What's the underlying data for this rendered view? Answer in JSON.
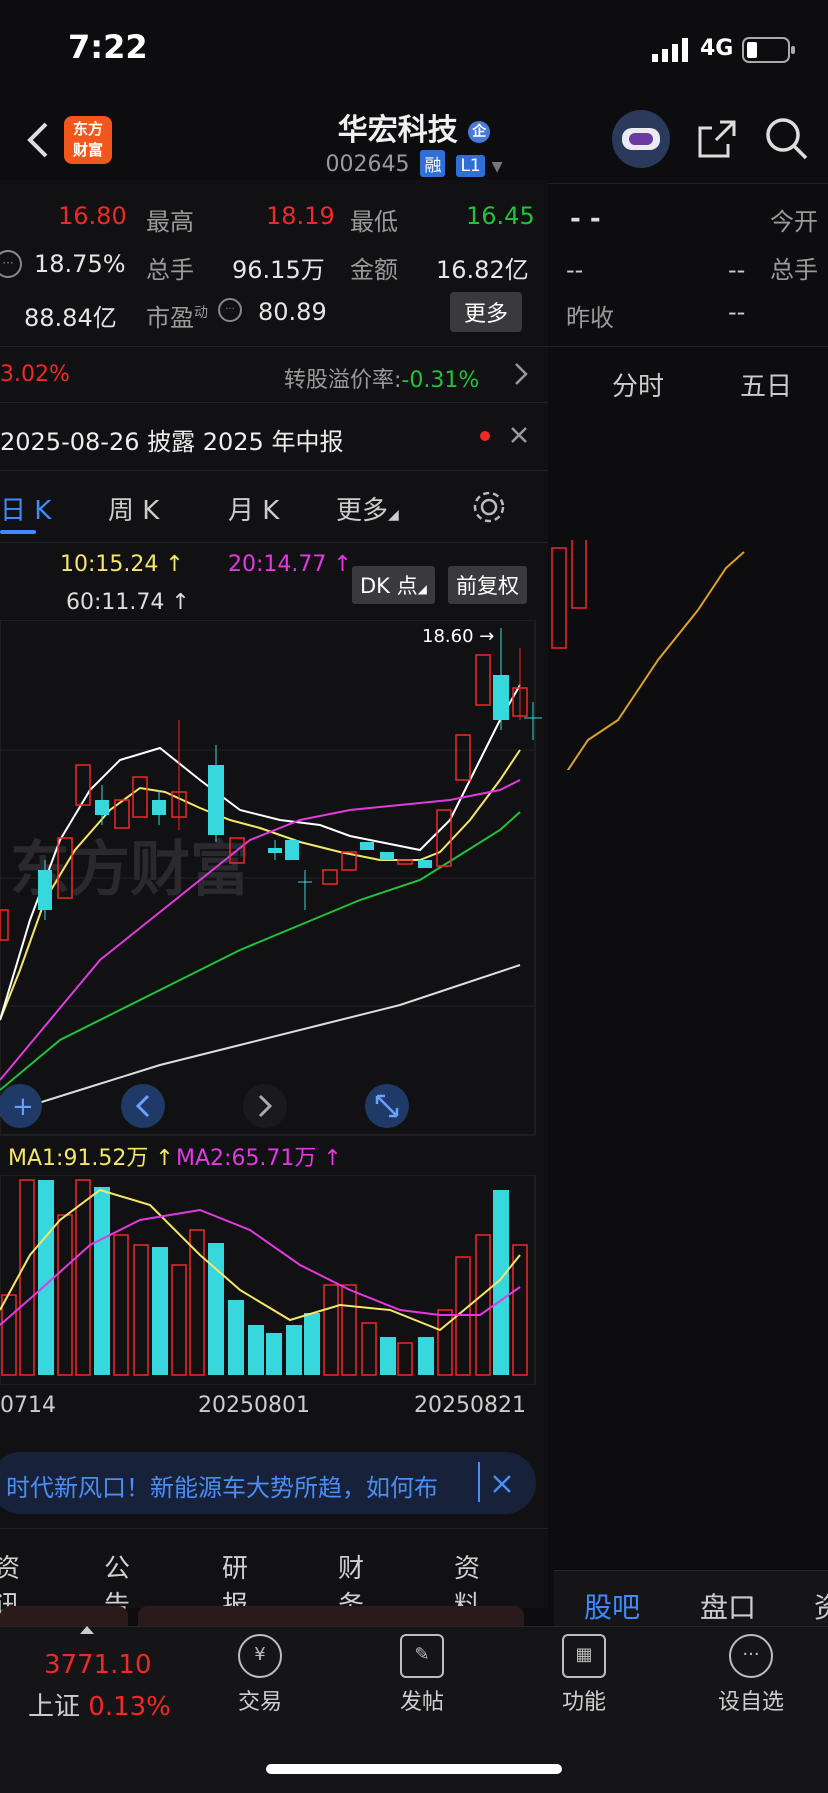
{
  "status": {
    "time": "7:22",
    "network": "4G"
  },
  "header": {
    "logo_text_1": "东方",
    "logo_text_2": "财富",
    "title": "华宏科技",
    "badge": "企",
    "code": "002645",
    "tag1": "融",
    "tag2": "L1"
  },
  "quote": {
    "row1": {
      "v0": "16.80",
      "l1": "最高",
      "v1": "18.19",
      "l2": "最低",
      "v2": "16.45"
    },
    "row2": {
      "v0": "18.75%",
      "l1": "总手",
      "v1": "96.15万",
      "l2": "金额",
      "v2": "16.82亿"
    },
    "row3": {
      "v0": "88.84亿",
      "l1": "市盈",
      "l1_sup": "动",
      "v1": "80.89",
      "more": "更多"
    },
    "right": {
      "dash": "- -",
      "open_label": "今开",
      "r2_a": "--",
      "r2_b": "--",
      "vol_label": "总手",
      "prev_label": "昨收",
      "r3": "--"
    }
  },
  "info": {
    "pct": "3.02%",
    "premium_label": "转股溢价率:",
    "premium_value": "-0.31%",
    "notice": "2025-08-26 披露 2025 年中报"
  },
  "right_tabs": [
    "分时",
    "五日"
  ],
  "k_tabs": {
    "day": "日 K",
    "week": "周 K",
    "month": "月 K",
    "more": "更多"
  },
  "ma": {
    "ma10": "10:15.24",
    "ma20": "20:14.77",
    "ma60": "60:11.74",
    "dk": "DK 点",
    "adj": "前复权"
  },
  "chart": {
    "peak_label": "18.60",
    "watermark": "东方财富"
  },
  "vol": {
    "ma1": "MA1:91.52万",
    "ma2": "MA2:65.71万"
  },
  "dates": [
    "0714",
    "20250801",
    "20250821"
  ],
  "banner": "时代新风口！新能源车大势所趋，如何布",
  "bottom_tabs": [
    "资讯",
    "公告",
    "研报",
    "财务",
    "资料"
  ],
  "right_bottom_tabs": [
    "股吧",
    "盘口",
    "资"
  ],
  "nav": {
    "index_value": "3771.10",
    "index_name": "上证",
    "index_pct": "0.13%",
    "items": [
      "交易",
      "发帖",
      "功能",
      "设自选"
    ]
  }
}
